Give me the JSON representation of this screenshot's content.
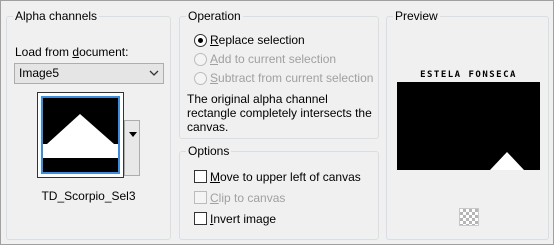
{
  "alpha_channels": {
    "title": "Alpha channels",
    "load_label_prefix": "Load from ",
    "load_label_ul": "d",
    "load_label_suffix": "ocument:",
    "document_select": {
      "value": "Image5"
    },
    "channel_name": "TD_Scorpio_Sel3"
  },
  "operation": {
    "title": "Operation",
    "options": [
      {
        "ul": "R",
        "rest": "eplace selection",
        "selected": true,
        "enabled": true
      },
      {
        "ul": "A",
        "rest": "dd to current selection",
        "selected": false,
        "enabled": false
      },
      {
        "ul": "S",
        "rest": "ubtract from current selection",
        "selected": false,
        "enabled": false
      }
    ],
    "description_line1": "The original alpha channel",
    "description_line2": "rectangle completely intersects the",
    "description_line3": "canvas."
  },
  "options": {
    "title": "Options",
    "checks": [
      {
        "ul": "M",
        "rest": "ove to upper left of canvas",
        "checked": false,
        "enabled": true
      },
      {
        "ul": "C",
        "rest": "lip to canvas",
        "checked": false,
        "enabled": false
      },
      {
        "ul": "I",
        "rest": "nvert image",
        "checked": false,
        "enabled": true
      }
    ]
  },
  "preview": {
    "title": "Preview",
    "caption": "ESTELA FONSECA"
  },
  "icons": {
    "dropdown": "chevron-down-icon",
    "thumb_menu": "triangle-down-icon",
    "transparency": "checkerboard-icon"
  },
  "colors": {
    "selection_border": "#3c8ddc",
    "background": "#f0f0f0"
  }
}
